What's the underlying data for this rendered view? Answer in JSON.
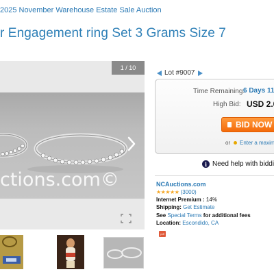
{
  "breadcrumb": "2025 November Warehouse Estate Sale Auction",
  "title": "r Engagement ring Set 3 Grams Size 7",
  "gallery": {
    "counter": "1 / 10",
    "watermark": "ctions.com©",
    "icons": [
      "chevron-right-icon",
      "expand-icon"
    ],
    "thumbnail_count": 3
  },
  "lot": {
    "label": "Lot #9007"
  },
  "bid_box": {
    "time_label": "Time Remaining:",
    "time_value": "6 Days 11",
    "high_bid_label": "High Bid:",
    "high_bid_value": "USD 2.0",
    "bid_button": "BID NOW S",
    "or_text": "or",
    "max_bid_link": "Enter a maximan"
  },
  "help": {
    "label": "Need help with biddin"
  },
  "seller": {
    "name": "NCAuctions.com",
    "stars": "★★★★★",
    "rating_count": "(3000)",
    "premium_label": "Internet Premium :",
    "premium_value": "14%",
    "shipping_label": "Shipping:",
    "shipping_value": "Get Estimate",
    "terms_prefix": "See",
    "terms_link": "Special Terms",
    "terms_suffix": "for additional fees",
    "location_label": "Location:",
    "location_value": "Escondido, CA",
    "pdf_icon": "pdf"
  },
  "colors": {
    "link": "#2a79b4",
    "bid_button": "#f46a0a",
    "stars": "#f5a623"
  }
}
